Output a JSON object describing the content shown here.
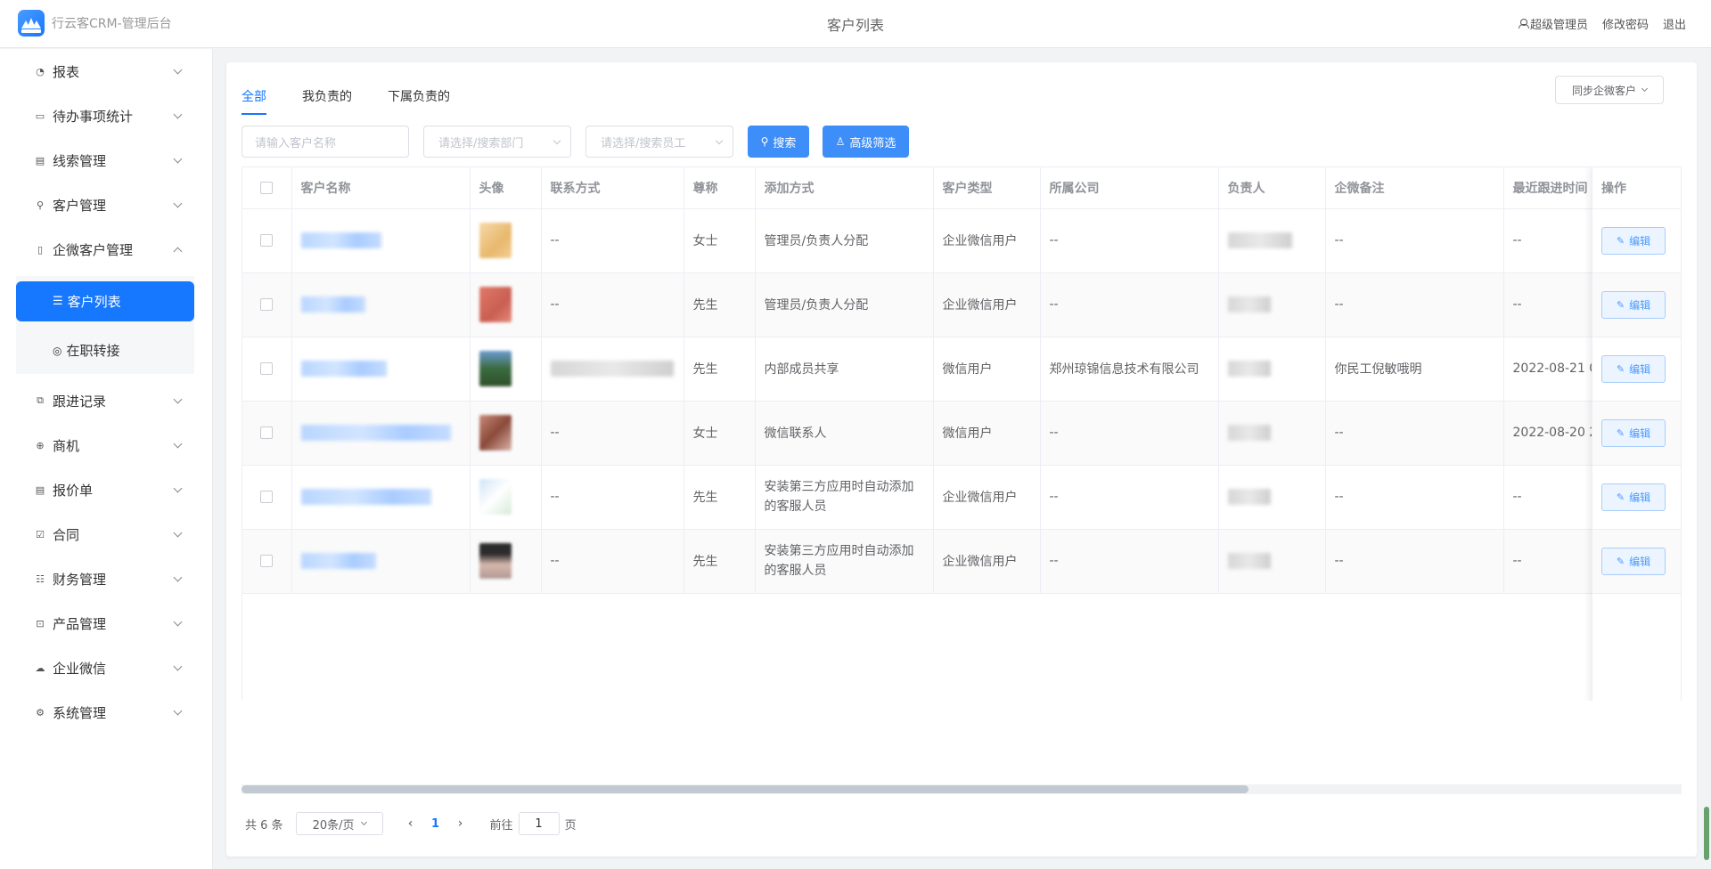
{
  "header": {
    "app_name": "行云客CRM-管理后台",
    "page_title": "客户列表",
    "user_label": "超级管理员",
    "change_password": "修改密码",
    "logout": "退出"
  },
  "sidebar": {
    "items": [
      {
        "label": "报表",
        "icon": "dashboard-icon"
      },
      {
        "label": "待办事项统计",
        "icon": "chat-icon"
      },
      {
        "label": "线索管理",
        "icon": "clue-icon"
      },
      {
        "label": "客户管理",
        "icon": "user-icon"
      },
      {
        "label": "企微客户管理",
        "icon": "phone-icon",
        "expanded": true
      },
      {
        "label": "跟进记录",
        "icon": "followup-icon"
      },
      {
        "label": "商机",
        "icon": "opportunity-icon"
      },
      {
        "label": "报价单",
        "icon": "document-icon"
      },
      {
        "label": "合同",
        "icon": "contract-icon"
      },
      {
        "label": "财务管理",
        "icon": "database-icon"
      },
      {
        "label": "产品管理",
        "icon": "product-icon"
      },
      {
        "label": "企业微信",
        "icon": "wechat-icon"
      },
      {
        "label": "系统管理",
        "icon": "gear-icon"
      }
    ],
    "subitems": [
      {
        "label": "客户列表",
        "icon": "list-icon",
        "active": true
      },
      {
        "label": "在职转接",
        "icon": "transfer-icon"
      }
    ]
  },
  "tabs": [
    "全部",
    "我负责的",
    "下属负责的"
  ],
  "active_tab": "全部",
  "sync_button": "同步企微客户",
  "filters": {
    "name_placeholder": "请输入客户名称",
    "dept_placeholder": "请选择/搜索部门",
    "staff_placeholder": "请选择/搜索员工",
    "search_button": "搜索",
    "advanced_button": "高级筛选"
  },
  "table": {
    "columns": [
      "客户名称",
      "头像",
      "联系方式",
      "尊称",
      "添加方式",
      "客户类型",
      "所属公司",
      "负责人",
      "企微备注",
      "最近跟进时间",
      "操作"
    ],
    "rows": [
      {
        "name": "",
        "contact": "--",
        "title": "女士",
        "add_method": "管理员/负责人分配",
        "type": "企业微信用户",
        "company": "--",
        "owner": "",
        "remark": "--",
        "last_follow": "--"
      },
      {
        "name": "",
        "contact": "--",
        "title": "先生",
        "add_method": "管理员/负责人分配",
        "type": "企业微信用户",
        "company": "--",
        "owner": "",
        "remark": "--",
        "last_follow": "--"
      },
      {
        "name": "",
        "contact": "",
        "title": "先生",
        "add_method": "内部成员共享",
        "type": "微信用户",
        "company": "郑州琼锦信息技术有限公司",
        "owner": "",
        "remark": "你民工倪敏哦明",
        "last_follow": "2022-08-21 0"
      },
      {
        "name": "",
        "contact": "--",
        "title": "女士",
        "add_method": "微信联系人",
        "type": "微信用户",
        "company": "--",
        "owner": "",
        "remark": "--",
        "last_follow": "2022-08-20 2"
      },
      {
        "name": "",
        "contact": "--",
        "title": "先生",
        "add_method": "安装第三方应用时自动添加的客服人员",
        "type": "企业微信用户",
        "company": "--",
        "owner": "",
        "remark": "--",
        "last_follow": "--"
      },
      {
        "name": "",
        "contact": "--",
        "title": "先生",
        "add_method": "安装第三方应用时自动添加的客服人员",
        "type": "企业微信用户",
        "company": "--",
        "owner": "",
        "remark": "--",
        "last_follow": "--"
      }
    ],
    "edit_label": "编辑"
  },
  "pagination": {
    "total": "共 6 条",
    "page_size": "20条/页",
    "current_page": "1",
    "goto_prefix": "前往",
    "goto_value": "1",
    "goto_suffix": "页"
  },
  "colors": {
    "accent": "#1677ff",
    "primary_button": "#3d8ef8"
  }
}
